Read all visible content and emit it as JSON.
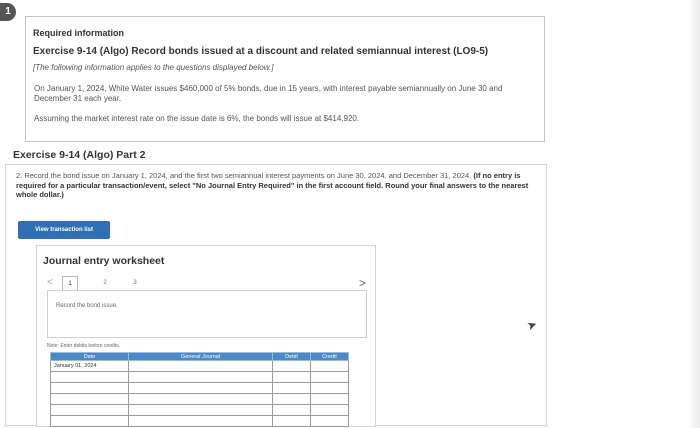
{
  "info": {
    "badge": "1",
    "title": "Required information",
    "exercise": "Exercise 9-14 (Algo) Record bonds issued at a discount and related semiannual interest (LO9-5)",
    "note": "[The following information applies to the questions displayed below.]",
    "para1": "On January 1, 2024, White Water issues $460,000 of 5% bonds, due in 15 years, with interest payable semiannually on June 30 and December 31 each year.",
    "para2": "Assuming the market interest rate on the issue date is 6%, the bonds will issue at $414,920."
  },
  "part": {
    "title": "Exercise 9-14 (Algo) Part 2",
    "instruction": "2. Record the bond issue on January 1, 2024, and the first two semiannual interest payments on June 30, 2024, and December 31, 2024.",
    "instruction_bold": "(If no entry is required for a particular transaction/event, select \"No Journal Entry Required\" in the first account field. Round your final answers to the nearest whole dollar.)",
    "view_button": "View transaction list"
  },
  "worksheet": {
    "title": "Journal entry worksheet",
    "prev": "<",
    "next": ">",
    "pages": [
      "1",
      "2",
      "3"
    ],
    "record_text": "Record the bond issue.",
    "note": "Note: Enter debits before credits.",
    "columns": [
      "Date",
      "General Journal",
      "Debit",
      "Credit"
    ],
    "rows": [
      [
        "January 01, 2024",
        "",
        "",
        ""
      ],
      [
        "",
        "",
        "",
        ""
      ],
      [
        "",
        "",
        "",
        ""
      ],
      [
        "",
        "",
        "",
        ""
      ],
      [
        "",
        "",
        "",
        ""
      ],
      [
        "",
        "",
        "",
        ""
      ]
    ]
  }
}
